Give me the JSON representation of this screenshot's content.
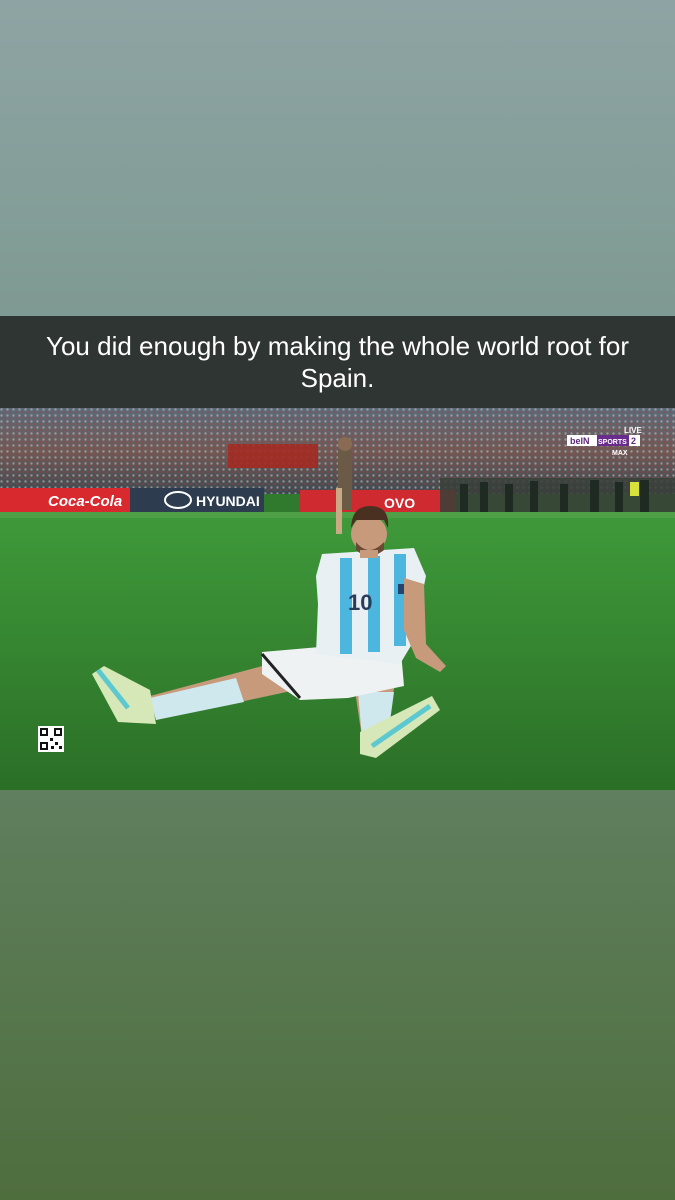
{
  "caption": {
    "text": "You did enough by making the whole world root for Spain."
  },
  "photo": {
    "broadcast_logo": {
      "brand": "beIN",
      "channel": "SPORTS",
      "number": "2",
      "live": "LIVE",
      "tier": "MAX"
    },
    "sponsor_boards": {
      "left": "Coca-Cola",
      "center": "HYUNDAI",
      "right": "OVO"
    },
    "jersey_number": "10",
    "icons": [
      "qr-code-icon"
    ]
  }
}
